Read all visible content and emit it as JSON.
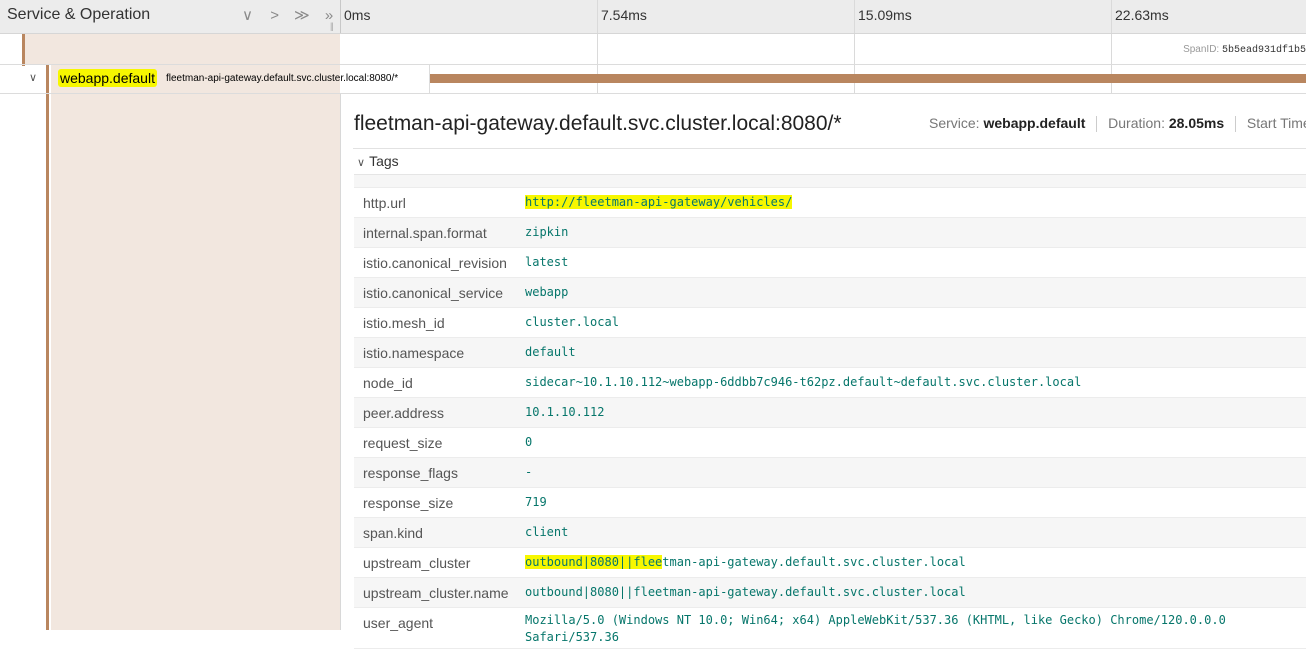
{
  "header": {
    "title": "Service & Operation",
    "controls": [
      "∨",
      ">",
      "≫",
      "»"
    ],
    "ticks": [
      "0ms",
      "7.54ms",
      "15.09ms",
      "22.63ms"
    ]
  },
  "parent": {
    "span_id_label": "SpanID:",
    "span_id_value": "5b5ead931df1b5"
  },
  "span": {
    "service": "webapp.default",
    "operation": "fleetman-api-gateway.default.svc.cluster.local:8080/*",
    "color": "#b9865f"
  },
  "detail": {
    "title": "fleetman-api-gateway.default.svc.cluster.local:8080/*",
    "service_label": "Service:",
    "service_value": "webapp.default",
    "duration_label": "Duration:",
    "duration_value": "28.05ms",
    "start_label": "Start Time:",
    "tags_label": "Tags",
    "tags": [
      {
        "key": "http.url",
        "value": "http://fleetman-api-gateway/vehicles/"
      },
      {
        "key": "internal.span.format",
        "value": "zipkin"
      },
      {
        "key": "istio.canonical_revision",
        "value": "latest"
      },
      {
        "key": "istio.canonical_service",
        "value": "webapp"
      },
      {
        "key": "istio.mesh_id",
        "value": "cluster.local"
      },
      {
        "key": "istio.namespace",
        "value": "default"
      },
      {
        "key": "node_id",
        "value": "sidecar~10.1.10.112~webapp-6ddbb7c946-t62pz.default~default.svc.cluster.local"
      },
      {
        "key": "peer.address",
        "value": "10.1.10.112"
      },
      {
        "key": "request_size",
        "value": "0"
      },
      {
        "key": "response_flags",
        "value": "-"
      },
      {
        "key": "response_size",
        "value": "719"
      },
      {
        "key": "span.kind",
        "value": "client"
      },
      {
        "key": "upstream_cluster",
        "value_hl": "outbound|8080||flee",
        "value_rest": "tman-api-gateway.default.svc.cluster.local"
      },
      {
        "key": "upstream_cluster.name",
        "value": "outbound|8080||fleetman-api-gateway.default.svc.cluster.local"
      },
      {
        "key": "user_agent",
        "value": "Mozilla/5.0 (Windows NT 10.0; Win64; x64) AppleWebKit/537.36 (KHTML, like Gecko) Chrome/120.0.0.0 Safari/537.36"
      }
    ]
  },
  "colors": {
    "accent": "#b9865f",
    "span_shade": "#f2e7df",
    "highlight": "#f7f700",
    "tag_value": "#06766b"
  }
}
